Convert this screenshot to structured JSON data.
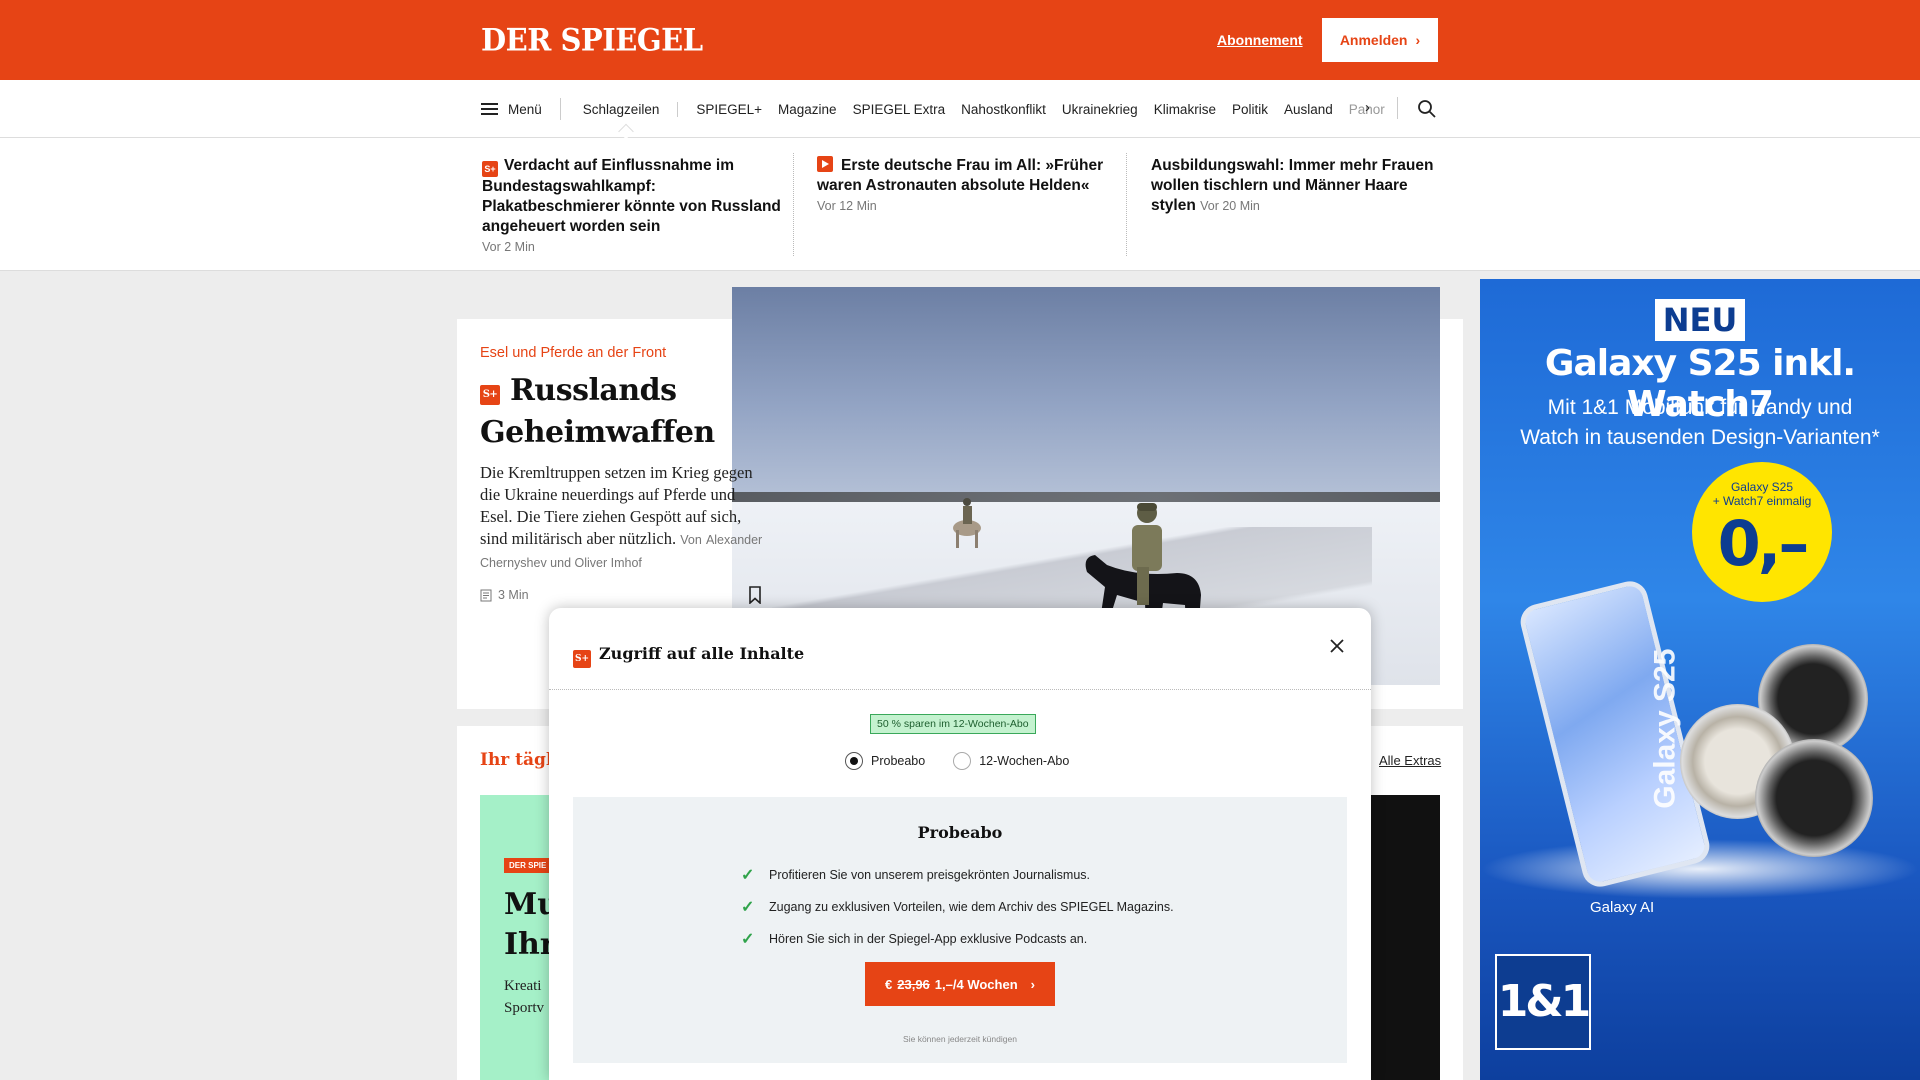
{
  "header": {
    "logo": "DER SPIEGEL",
    "abo_link": "Abonnement",
    "login_label": "Anmelden"
  },
  "nav": {
    "menu_label": "Menü",
    "items": [
      "Schlagzeilen",
      "SPIEGEL+",
      "Magazine",
      "SPIEGEL Extra",
      "Nahostkonflikt",
      "Ukrainekrieg",
      "Klimakrise",
      "Politik",
      "Ausland",
      "Panor"
    ],
    "active": "Schlagzeilen"
  },
  "ticker": [
    {
      "title": "Verdacht auf Einflussnahme im Bundestagswahlkampf: Plakatbeschmierer könnte von Russland angeheuert worden sein",
      "time": "Vor 2 Min",
      "badge": "S+"
    },
    {
      "title": "Erste deutsche Frau im All: »Früher waren Astronauten absolute Helden«",
      "time": "Vor 12 Min",
      "badge": "play"
    },
    {
      "title": "Ausbildungswahl: Immer mehr Frauen wollen tischlern und Männer Haare stylen",
      "time": "Vor 20 Min",
      "badge": ""
    }
  ],
  "teaser": {
    "kicker": "Esel und Pferde an der Front",
    "badge": "S+",
    "title": "Russlands Geheimwaffen",
    "text": "Die Kremltruppen setzen im Krieg gegen die Ukraine neuerdings auf Pferde und Esel. Die Tiere ziehen Gespött auf sich, sind militärisch aber nützlich.",
    "author_prefix": "Von",
    "authors": "Alexander Chernyshev und Oliver Imhof",
    "reading_time": "3 Min"
  },
  "section": {
    "title_partial": "Ihr täglic",
    "link": "Alle Extras",
    "promo_tag": "DER SPIE",
    "promo_head_1": "Mu",
    "promo_head_2": "Ihr",
    "promo_sub_1": "Kreati",
    "promo_sub_2": "Sportv"
  },
  "ad": {
    "neu": "NEU",
    "title": "Galaxy S25 inkl. Watch7",
    "sub_1": "Mit 1&1 Mobilfunk für Handy und",
    "sub_2": "Watch in tausenden Design-Varianten*",
    "circle_small_1": "Galaxy S25",
    "circle_small_2": "+ Watch7 einmalig",
    "circle_price": "0,–",
    "phone_label": "Galaxy S25",
    "galaxy_ai": "Galaxy AI",
    "logo": "1&1"
  },
  "modal": {
    "badge": "S+",
    "title": "Zugriff auf alle Inhalte",
    "save_badge": "50 % sparen im 12-Wochen-Abo",
    "options": [
      "Probeabo",
      "12-Wochen-Abo"
    ],
    "selected": "Probeabo",
    "offer_title": "Probeabo",
    "benefits": [
      "Profitieren Sie von unserem preisgekrönten Journalismus.",
      "Zugang zu exklusiven Vorteilen, wie dem Archiv des SPIEGEL Magazins.",
      "Hören Sie sich in der Spiegel-App exklusive Podcasts an."
    ],
    "cta_currency": "€",
    "cta_old_price": "23,96",
    "cta_new_price": "1,–/4 Wochen",
    "cancel_note": "Sie können jederzeit kündigen"
  },
  "colors": {
    "brand": "#e64415",
    "ad_blue": "#1e6ad6",
    "check_green": "#2fa34a"
  }
}
